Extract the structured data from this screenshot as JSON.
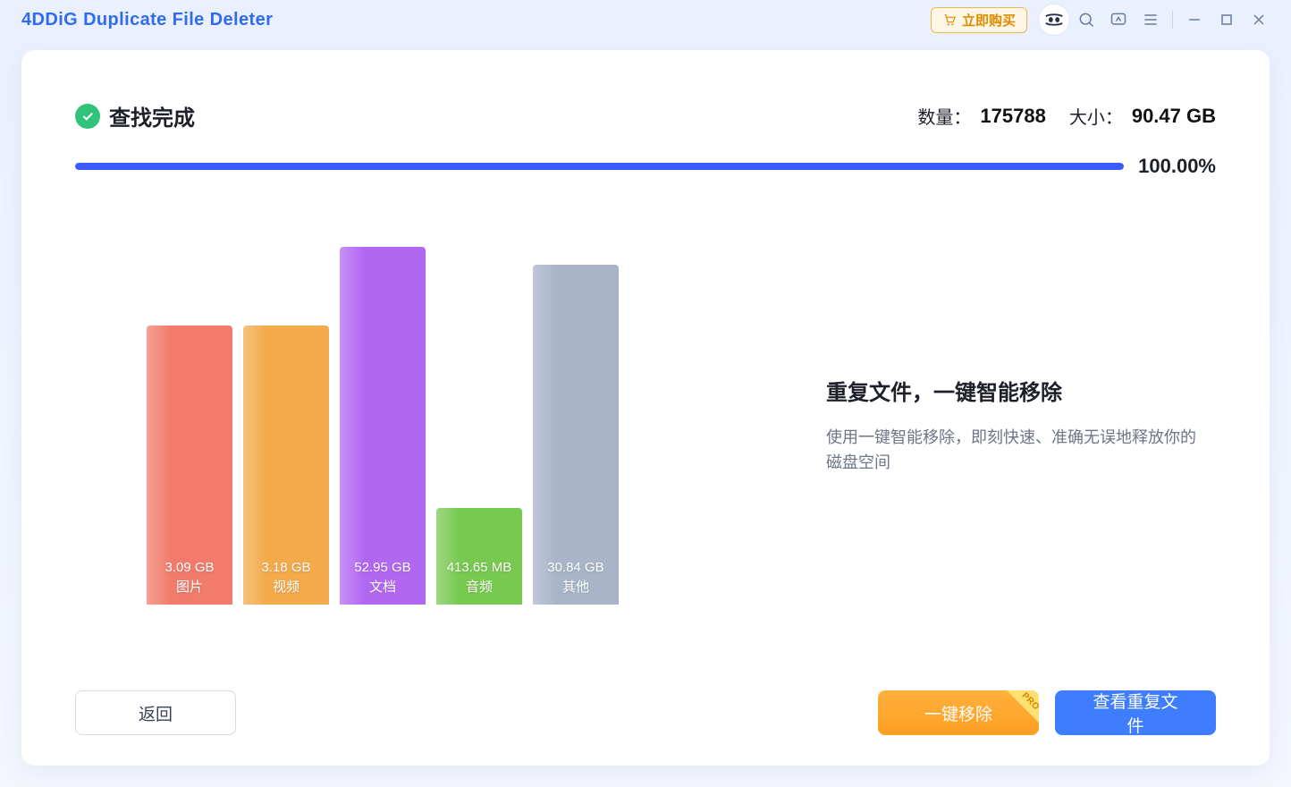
{
  "app": {
    "title": "4DDiG Duplicate File Deleter",
    "buy_label": "立即购买"
  },
  "status": {
    "title": "查找完成",
    "count_label": "数量：",
    "count_value": "175788",
    "size_label": "大小：",
    "size_value": "90.47 GB",
    "progress_pct": "100.00%"
  },
  "side": {
    "heading": "重复文件，一键智能移除",
    "body": "使用一键智能移除，即刻快速、准确无误地释放你的磁盘空间"
  },
  "buttons": {
    "back": "返回",
    "smart_remove": "一键移除",
    "pro_badge": "PRO",
    "view_dupes": "查看重复文件"
  },
  "chart_data": {
    "type": "bar",
    "title": "",
    "xlabel": "",
    "ylabel": "",
    "categories": [
      "图片",
      "视频",
      "文档",
      "音频",
      "其他"
    ],
    "value_labels": [
      "3.09 GB",
      "3.18 GB",
      "52.95 GB",
      "413.65 MB",
      "30.84 GB"
    ],
    "values_gb": [
      3.09,
      3.18,
      52.95,
      0.404,
      30.84
    ],
    "height_pct": [
      78,
      78,
      100,
      27,
      95
    ],
    "colors": [
      "#f27b6b",
      "#f4a94b",
      "#b267f3",
      "#77c94f",
      "#a9b4c8"
    ]
  }
}
